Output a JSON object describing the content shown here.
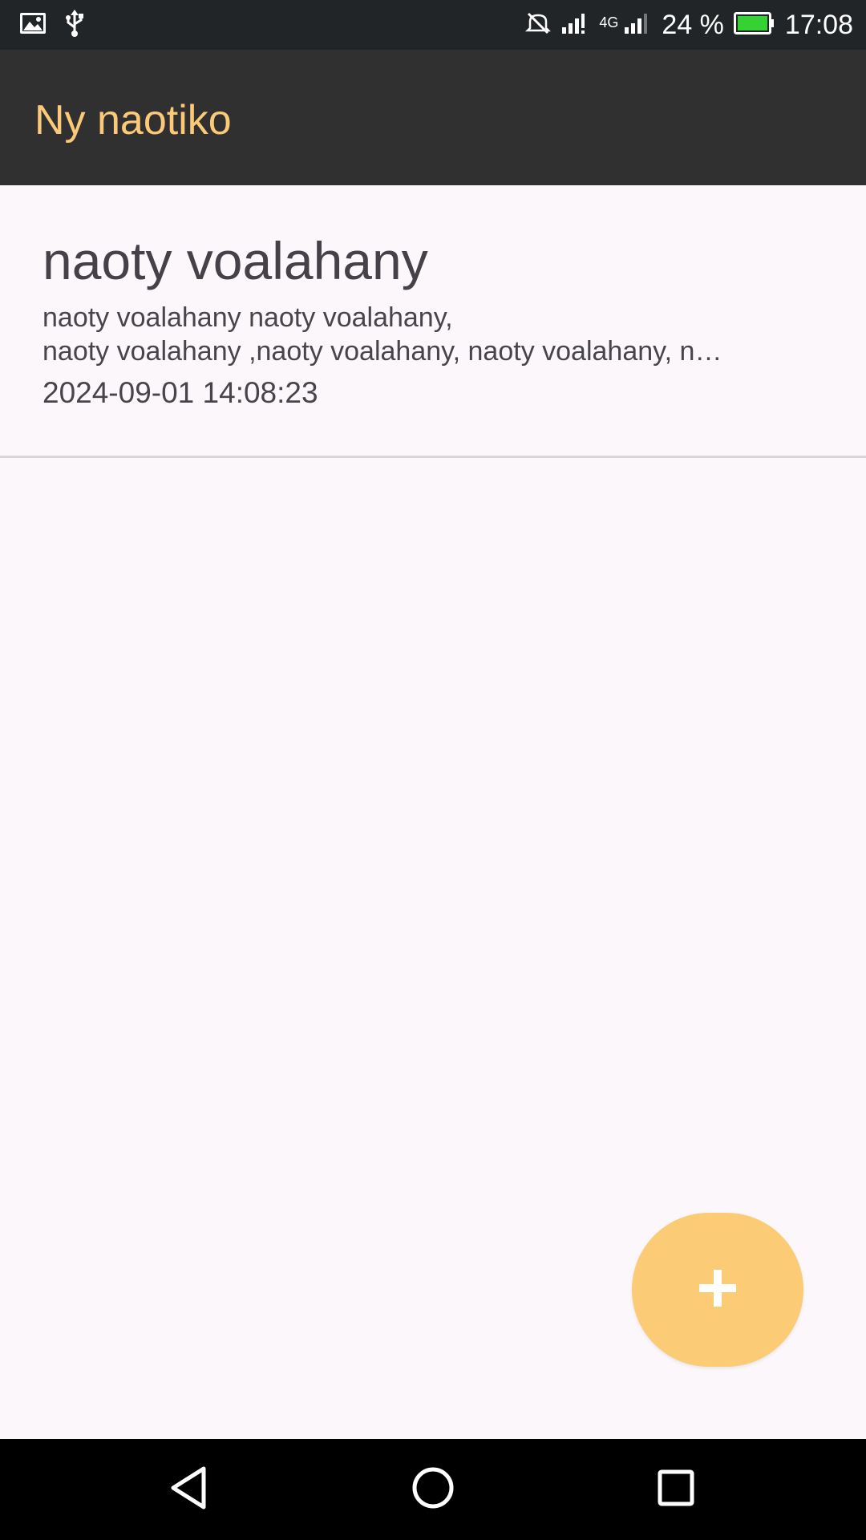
{
  "status_bar": {
    "battery_percent": "24 %",
    "network_label": "4G",
    "time": "17:08",
    "icons": [
      "image-icon",
      "usb-icon",
      "mute-icon",
      "signal-icon",
      "signal-icon-2",
      "battery-icon"
    ]
  },
  "app_bar": {
    "title": "Ny naotiko"
  },
  "notes": [
    {
      "title": "naoty voalahany",
      "body_line_1": "naoty voalahany naoty voalahany,",
      "body_line_2": "naoty voalahany ,naoty voalahany, naoty voalahany, naoty voalahany",
      "date": "2024-09-01 14:08:23"
    }
  ],
  "fab": {
    "icon": "plus-icon"
  },
  "nav_bar": {
    "buttons": [
      "back-icon",
      "home-icon",
      "recents-icon"
    ]
  },
  "colors": {
    "accent": "#fbc978",
    "fab": "#fccb76",
    "app_bar": "#303030",
    "background": "#fbf7fb"
  }
}
